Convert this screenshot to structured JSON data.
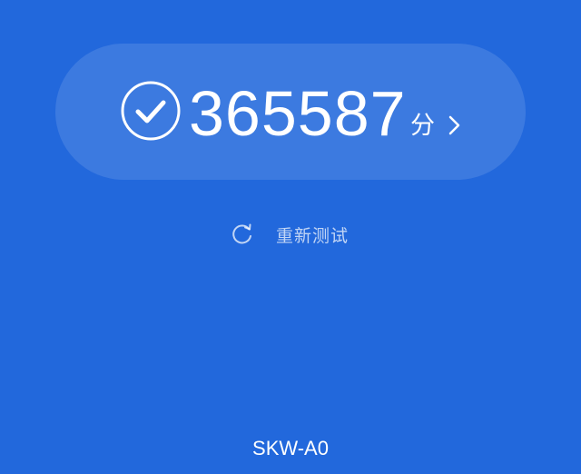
{
  "score": {
    "value": "365587",
    "unit": "分",
    "status_icon": "check-circle-icon",
    "detail_icon": "chevron-right-icon"
  },
  "retest": {
    "label": "重新测试",
    "icon": "refresh-icon"
  },
  "device": {
    "name": "SKW-A0"
  },
  "colors": {
    "background": "#2268dc",
    "card": "rgba(255,255,255,0.12)",
    "text": "#ffffff",
    "muted_text": "rgba(255,255,255,0.72)"
  }
}
